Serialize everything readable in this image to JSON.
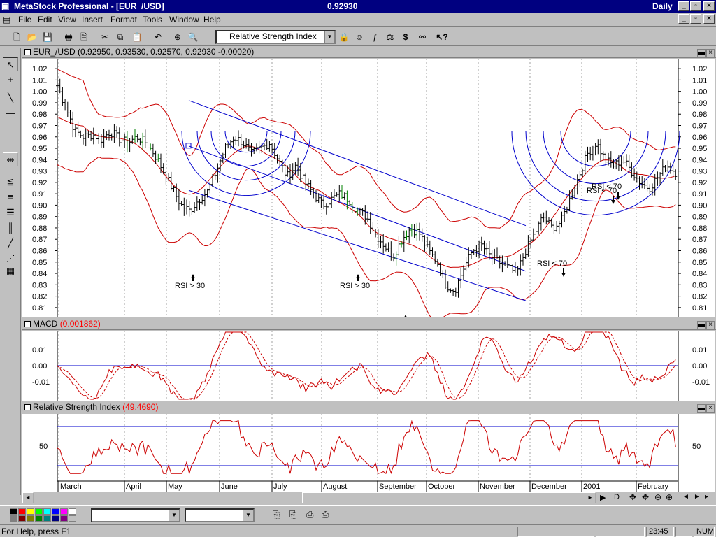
{
  "window": {
    "title": "MetaStock Professional - [EUR_/USD]",
    "price": "0.92930",
    "period": "Daily",
    "minimize": "_",
    "restore": "▫",
    "close": "×"
  },
  "menu": [
    "File",
    "Edit",
    "View",
    "Insert",
    "Format",
    "Tools",
    "Window",
    "Help"
  ],
  "toolbar": {
    "indicator_select": "Relative Strength Index",
    "buttons": [
      "new-icon",
      "open-icon",
      "save-icon",
      "print-icon",
      "print-preview-icon",
      "cut-icon",
      "copy-icon",
      "paste-icon",
      "undo-icon",
      "crosshair-icon",
      "zoom-icon",
      "lock-icon",
      "expert-icon",
      "function-icon",
      "system-tester-icon",
      "explorer-icon",
      "binoculars-icon",
      "help-icon"
    ]
  },
  "left_tools": [
    "pointer-icon",
    "crosshair-tool-icon",
    "trendline-icon",
    "horizontal-line-icon",
    "vertical-line-icon",
    "arrange-icon",
    "speed-line-icon",
    "fan-icon",
    "fibonacci-icon",
    "cycle-lines-icon",
    "raff-channel-icon",
    "gann-fan-icon",
    "grid-icon"
  ],
  "panes": {
    "price": {
      "label": "EUR_/USD",
      "values": "(0.92950, 0.93530, 0.92570, 0.92930 -0.00020)",
      "yticks": [
        "1.02",
        "1.01",
        "1.00",
        "0.99",
        "0.98",
        "0.97",
        "0.96",
        "0.95",
        "0.94",
        "0.93",
        "0.92",
        "0.91",
        "0.90",
        "0.89",
        "0.88",
        "0.87",
        "0.86",
        "0.85",
        "0.84",
        "0.83",
        "0.82",
        "0.81"
      ],
      "annotations": [
        {
          "text": "RSI > 30",
          "x": 5.0,
          "y": 0.883,
          "arrow": "up"
        },
        {
          "text": "RSI > 30",
          "x": 13.8,
          "y": 0.883,
          "arrow": "up"
        },
        {
          "text": "RSI > 30",
          "x": 18.6,
          "y": 0.849,
          "arrow": "up"
        },
        {
          "text": "RSI > 30",
          "x": 19.1,
          "y": 0.842,
          "arrow": "up"
        },
        {
          "text": "RSI > 30",
          "x": 19.6,
          "y": 0.832,
          "arrow": "up"
        },
        {
          "text": "RSI > 30",
          "x": 22.3,
          "y": 0.824,
          "arrow": "up"
        },
        {
          "text": "RSI > 30",
          "x": 22.6,
          "y": 0.821,
          "arrow": "up"
        },
        {
          "text": "RSI > 30",
          "x": 22.8,
          "y": 0.814,
          "arrow": "up"
        },
        {
          "text": "RSI < 70",
          "x": 27.5,
          "y": 0.893,
          "arrow": "down"
        },
        {
          "text": "RSI < 70",
          "x": 30.3,
          "y": 0.963,
          "arrow": "down"
        },
        {
          "text": "RSI < 70",
          "x": 30.6,
          "y": 0.965,
          "arrow": "down"
        }
      ]
    },
    "macd": {
      "label": "MACD",
      "value": "(0.001862)",
      "yticks": [
        "0.01",
        "0.00",
        "-0.01"
      ]
    },
    "rsi": {
      "label": "Relative Strength Index",
      "value": "(49.4690)",
      "yticks": [
        "50"
      ]
    }
  },
  "xaxis": {
    "months": [
      "March",
      "April",
      "May",
      "June",
      "July",
      "August",
      "September",
      "October",
      "November",
      "December",
      "2001",
      "February"
    ]
  },
  "bottom_toolbar": {
    "palette": [
      "#000000",
      "#ff0000",
      "#ffff00",
      "#00ff00",
      "#00ffff",
      "#0000ff",
      "#ff00ff",
      "#ffffff",
      "#808080",
      "#800000",
      "#808000",
      "#008000",
      "#008080",
      "#000080",
      "#800080",
      "#c0c0c0"
    ],
    "scroll_buttons": [
      "◄",
      "►",
      "D",
      "✥",
      "✥",
      "⊖",
      "⊕",
      "◄",
      "►"
    ]
  },
  "status": {
    "help": "For Help, press F1",
    "time": "23:45",
    "num": "NUM"
  },
  "colors": {
    "price_bars": "#000000",
    "bollinger": "#cc0000",
    "channel": "#0000cc",
    "green_bars": "#008000",
    "macd": "#cc0000",
    "rsi": "#cc0000",
    "rsi_bands": "#0000cc"
  },
  "chart_data": {
    "type": "line",
    "x_months": [
      "March",
      "April",
      "May",
      "June",
      "July",
      "August",
      "September",
      "October",
      "November",
      "December",
      "2001",
      "February"
    ],
    "price_ylim": [
      0.805,
      1.025
    ],
    "series": [
      {
        "name": "EUR_/USD",
        "values": [
          1.005,
          0.985,
          0.965,
          0.96,
          0.962,
          0.958,
          0.965,
          0.958,
          0.955,
          0.96,
          0.955,
          0.945,
          0.93,
          0.915,
          0.9,
          0.895,
          0.905,
          0.912,
          0.93,
          0.95,
          0.96,
          0.955,
          0.945,
          0.95,
          0.955,
          0.94,
          0.925,
          0.935,
          0.92,
          0.91,
          0.9,
          0.905,
          0.91,
          0.905,
          0.895,
          0.89,
          0.875,
          0.865,
          0.855,
          0.87,
          0.88,
          0.875,
          0.86,
          0.85,
          0.83,
          0.825,
          0.845,
          0.86,
          0.865,
          0.855,
          0.85,
          0.845,
          0.84,
          0.86,
          0.875,
          0.89,
          0.88,
          0.885,
          0.905,
          0.925,
          0.945,
          0.955,
          0.94,
          0.935,
          0.94,
          0.93,
          0.92,
          0.915,
          0.925,
          0.935,
          0.929
        ]
      }
    ],
    "macd_ylim": [
      -0.02,
      0.03
    ],
    "rsi_ylim": [
      20,
      80
    ]
  }
}
